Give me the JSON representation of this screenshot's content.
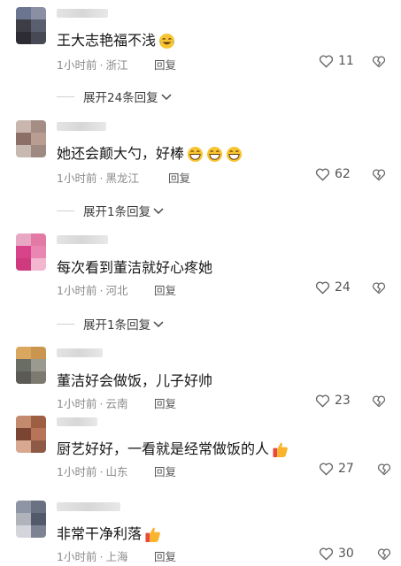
{
  "comments": [
    {
      "text": "王大志艳福不浅",
      "time": "1小时前",
      "location": "浙江",
      "reply_label": "回复",
      "likes": "11",
      "expand": "展开24条回复",
      "emoji": "laughing-tears-emoji",
      "avatar_colors": [
        "#6b7590",
        "#8a8fa3",
        "#3d3d46",
        "#5a5f70",
        "#2c2c32",
        "#474a55"
      ]
    },
    {
      "text": "她还会颠大勺，好棒",
      "time": "1小时前",
      "location": "黑龙江",
      "reply_label": "回复",
      "likes": "62",
      "expand": "展开1条回复",
      "emoji": "grinning-emoji",
      "avatar_colors": [
        "#c9b6ae",
        "#a48d84",
        "#8c6f66",
        "#b89d90",
        "#c7b8b0",
        "#9f8a82"
      ]
    },
    {
      "text": "每次看到董洁就好心疼她",
      "time": "1小时前",
      "location": "河北",
      "reply_label": "回复",
      "likes": "24",
      "expand": "展开1条回复",
      "avatar_colors": [
        "#e8a8c4",
        "#e27aa5",
        "#d9438a",
        "#e986b2",
        "#cf3a7f",
        "#f2b7cf"
      ]
    },
    {
      "text": "董洁好会做饭，儿子好帅",
      "time": "1小时前",
      "location": "云南",
      "reply_label": "回复",
      "likes": "23",
      "avatar_colors": [
        "#d9a85e",
        "#c9954f",
        "#6a6d63",
        "#9a9a90",
        "#5b5a54",
        "#7c7a70"
      ]
    },
    {
      "text": "厨艺好好，一看就是经常做饭的人",
      "time": "1小时前",
      "location": "山东",
      "reply_label": "回复",
      "likes": "27",
      "emoji": "thumbs-up-emoji",
      "avatar_colors": [
        "#c48a6e",
        "#9d5e44",
        "#7a4532",
        "#b87458",
        "#d8a890",
        "#8e5a45"
      ]
    },
    {
      "text": "非常干净利落",
      "time": "1小时前",
      "location": "上海",
      "reply_label": "回复",
      "likes": "30",
      "emoji": "thumbs-up-emoji",
      "avatar_colors": [
        "#8e95a4",
        "#6a7182",
        "#b0b3ba",
        "#52596a",
        "#d3d5da",
        "#7d8392"
      ]
    }
  ],
  "icons": {
    "like": "heart-outline-icon",
    "dislike": "broken-heart-icon",
    "expand": "chevron-down-icon"
  },
  "colors": {
    "meta_text": "#8a8a8a",
    "body_text": "#161616"
  }
}
